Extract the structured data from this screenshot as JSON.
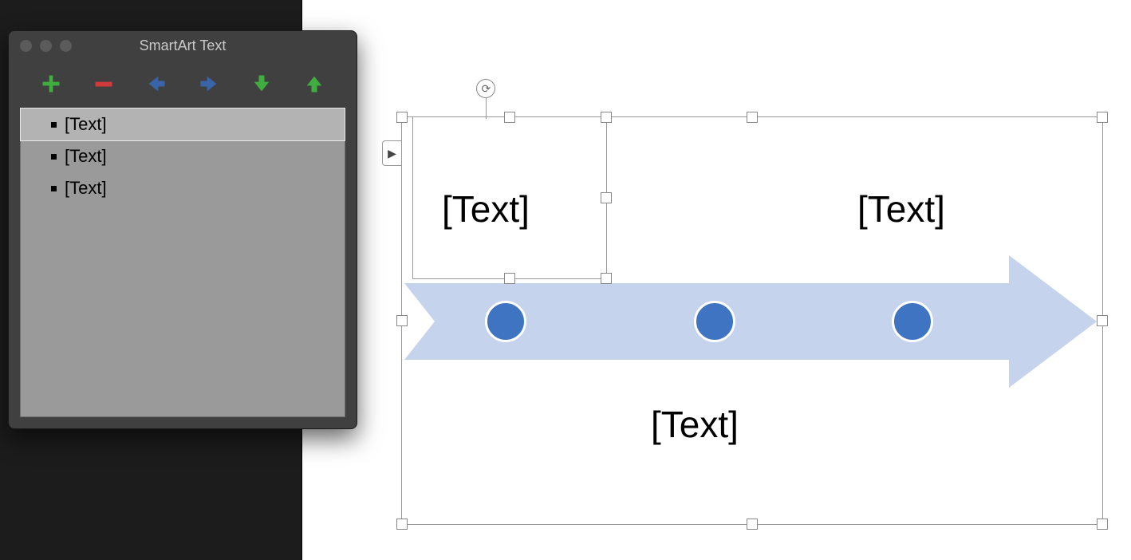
{
  "pane": {
    "title": "SmartArt Text",
    "toolbar": {
      "add": "add-item",
      "remove": "remove-item",
      "promote": "promote",
      "demote": "demote",
      "move_down": "move-down",
      "move_up": "move-up"
    },
    "items": [
      {
        "label": "[Text]",
        "selected": true
      },
      {
        "label": "[Text]",
        "selected": false
      },
      {
        "label": "[Text]",
        "selected": false
      }
    ]
  },
  "smartart": {
    "nodes": [
      {
        "label": "[Text]",
        "position": "top-left"
      },
      {
        "label": "[Text]",
        "position": "bottom-center"
      },
      {
        "label": "[Text]",
        "position": "top-right"
      }
    ],
    "colors": {
      "arrow_fill": "#c5d3ec",
      "dot_fill": "#3e74c1"
    }
  }
}
